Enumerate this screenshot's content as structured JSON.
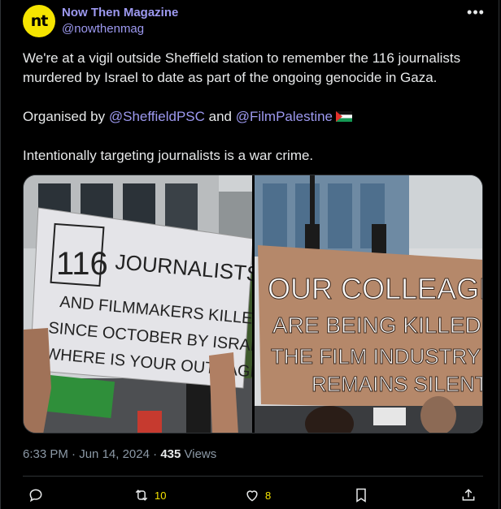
{
  "author": {
    "name": "Now Then Magazine",
    "handle": "@nowthenmag",
    "avatar_text": "nt"
  },
  "menu_icon": "more-icon",
  "tweet": {
    "line1": "We're at a vigil outside Sheffield station to remember the 116 journalists murdered by Israel to date as part of the ongoing genocide in Gaza.",
    "org_prefix": "Organised by ",
    "mention1": "@SheffieldPSC",
    "and": " and ",
    "mention2": "@FilmPalestine",
    "line3": "Intentionally targeting journalists is a war crime."
  },
  "images": {
    "left_sign": {
      "box_text": "116",
      "lines": [
        "JOURNALISTS",
        "AND FILMMAKERS KILLED",
        "SINCE OCTOBER BY ISRAEL",
        "WHERE IS YOUR OUTRAGE?"
      ]
    },
    "right_sign": {
      "lines": [
        "OUR COLLEAGES",
        "ARE BEING KILLED",
        "THE FILM INDUSTRY",
        "REMAINS SILENT"
      ]
    }
  },
  "meta": {
    "time": "6:33 PM",
    "dot": " · ",
    "date": "Jun 14, 2024",
    "dot2": " · ",
    "views_count": "435",
    "views_label": " Views"
  },
  "actions": {
    "reply_icon": "reply-icon",
    "retweet_icon": "retweet-icon",
    "retweet_count": "10",
    "like_icon": "heart-icon",
    "like_count": "8",
    "bookmark_icon": "bookmark-icon",
    "share_icon": "share-icon"
  },
  "colors": {
    "accent": "#9d99f0",
    "count_highlight": "#f5e400",
    "background": "#000000",
    "divider": "#2f3336"
  }
}
